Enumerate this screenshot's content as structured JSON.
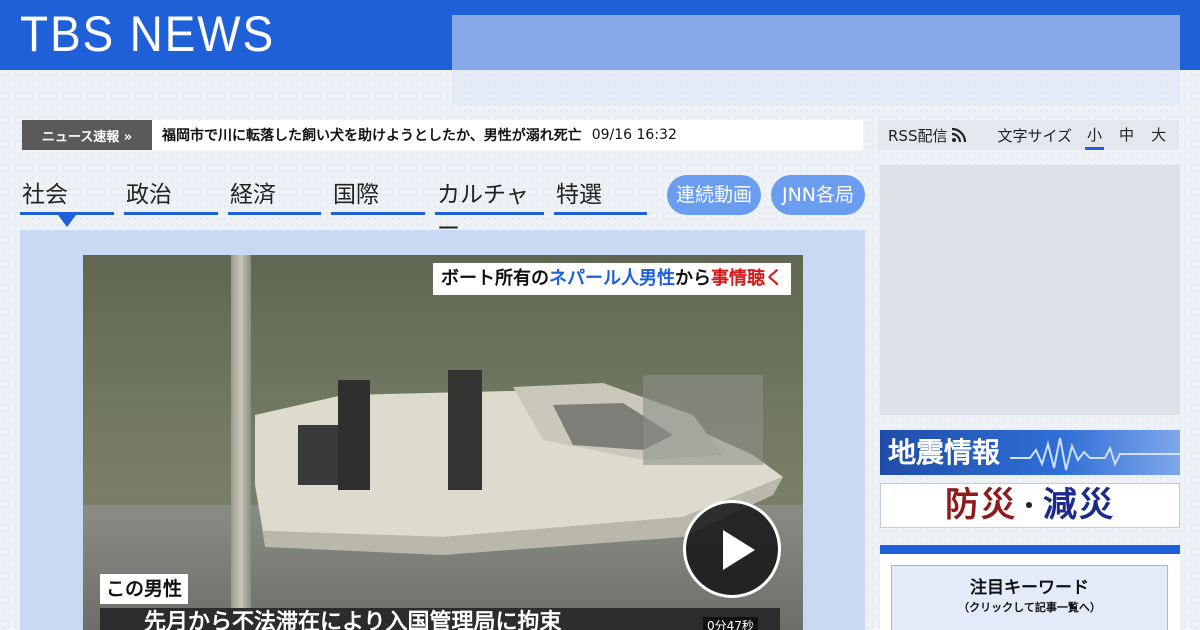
{
  "header": {
    "logo_text": "TBS NEWS"
  },
  "ticker": {
    "label": "ニュース速報 »",
    "headline": "福岡市で川に転落した飼い犬を助けようとしたか、男性が溺れ死亡",
    "time": "09/16 16:32"
  },
  "tools": {
    "rss_label": "RSS配信",
    "font_size_label": "文字サイズ",
    "font_sizes": [
      "小",
      "中",
      "大"
    ],
    "active_font_size": "小"
  },
  "nav": {
    "tabs": [
      "社会",
      "政治",
      "経済",
      "国際",
      "カルチャー",
      "特選"
    ],
    "active_tab": "社会",
    "pills": [
      "連続動画",
      "JNN各局"
    ]
  },
  "video": {
    "caption_top_1": "ボート所有の",
    "caption_top_2": "ネパール人男性",
    "caption_top_3": "から",
    "caption_top_4": "事情聴く",
    "caption_name": "この男性",
    "caption_bottom": "先月から不法滞在により入国管理局に拘束",
    "duration": "0分47秒"
  },
  "sidebar": {
    "quake_label": "地震情報",
    "bousai_1": "防災",
    "bousai_dot": "・",
    "bousai_2": "減災",
    "keyword_title": "注目キーワード",
    "keyword_sub": "（クリックして記事一覧へ）"
  },
  "colors": {
    "brand": "#1f5fd8",
    "pill": "#6a9cf0",
    "panel": "#c9d9f4"
  }
}
